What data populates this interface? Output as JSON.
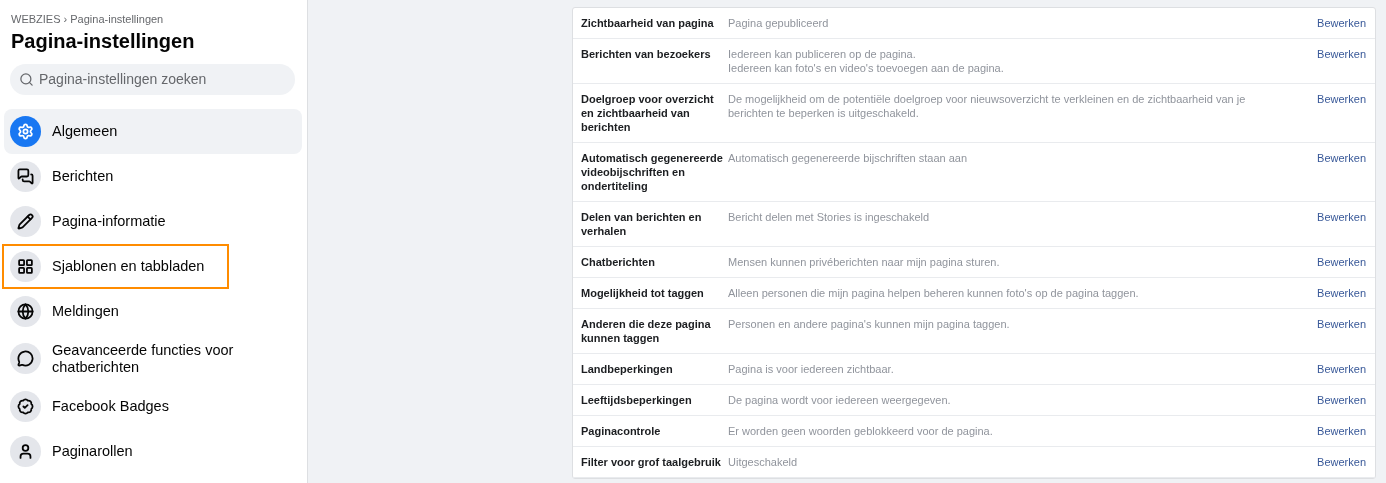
{
  "sidebar": {
    "breadcrumb": "WEBZIES › Pagina-instellingen",
    "title": "Pagina-instellingen",
    "search": {
      "placeholder": "Pagina-instellingen zoeken"
    },
    "items": [
      {
        "label": "Algemeen",
        "selected": true,
        "highlighted": false
      },
      {
        "label": "Berichten",
        "selected": false,
        "highlighted": false
      },
      {
        "label": "Pagina-informatie",
        "selected": false,
        "highlighted": false
      },
      {
        "label": "Sjablonen en tabbladen",
        "selected": false,
        "highlighted": true
      },
      {
        "label": "Meldingen",
        "selected": false,
        "highlighted": false
      },
      {
        "label": "Geavanceerde functies voor chatberichten",
        "selected": false,
        "highlighted": false
      },
      {
        "label": "Facebook Badges",
        "selected": false,
        "highlighted": false
      },
      {
        "label": "Paginarollen",
        "selected": false,
        "highlighted": false
      }
    ]
  },
  "settings": [
    {
      "name": "Zichtbaarheid van pagina",
      "lines": [
        "Pagina gepubliceerd"
      ],
      "action": "Bewerken"
    },
    {
      "name": "Berichten van bezoekers",
      "lines": [
        "Iedereen kan publiceren op de pagina.",
        "Iedereen kan foto's en video's toevoegen aan de pagina."
      ],
      "action": "Bewerken"
    },
    {
      "name": "Doelgroep voor overzicht en zichtbaarheid van berichten",
      "lines": [
        "De mogelijkheid om de potentiële doelgroep voor nieuwsoverzicht te verkleinen en de zichtbaarheid van je berichten te beperken is uitgeschakeld."
      ],
      "action": "Bewerken"
    },
    {
      "name": "Automatisch gegenereerde videobijschriften en ondertiteling",
      "lines": [
        "Automatisch gegenereerde bijschriften staan aan"
      ],
      "action": "Bewerken"
    },
    {
      "name": "Delen van berichten en verhalen",
      "lines": [
        "Bericht delen met Stories is ingeschakeld"
      ],
      "action": "Bewerken"
    },
    {
      "name": "Chatberichten",
      "lines": [
        "Mensen kunnen privéberichten naar mijn pagina sturen."
      ],
      "action": "Bewerken"
    },
    {
      "name": "Mogelijkheid tot taggen",
      "lines": [
        "Alleen personen die mijn pagina helpen beheren kunnen foto's op de pagina taggen."
      ],
      "action": "Bewerken"
    },
    {
      "name": "Anderen die deze pagina kunnen taggen",
      "lines": [
        "Personen en andere pagina's kunnen mijn pagina taggen."
      ],
      "action": "Bewerken"
    },
    {
      "name": "Landbeperkingen",
      "lines": [
        "Pagina is voor iedereen zichtbaar."
      ],
      "action": "Bewerken"
    },
    {
      "name": "Leeftijdsbeperkingen",
      "lines": [
        "De pagina wordt voor iedereen weergegeven."
      ],
      "action": "Bewerken"
    },
    {
      "name": "Paginacontrole",
      "lines": [
        "Er worden geen woorden geblokkeerd voor de pagina."
      ],
      "action": "Bewerken"
    },
    {
      "name": "Filter voor grof taalgebruik",
      "lines": [
        "Uitgeschakeld"
      ],
      "action": "Bewerken"
    }
  ]
}
